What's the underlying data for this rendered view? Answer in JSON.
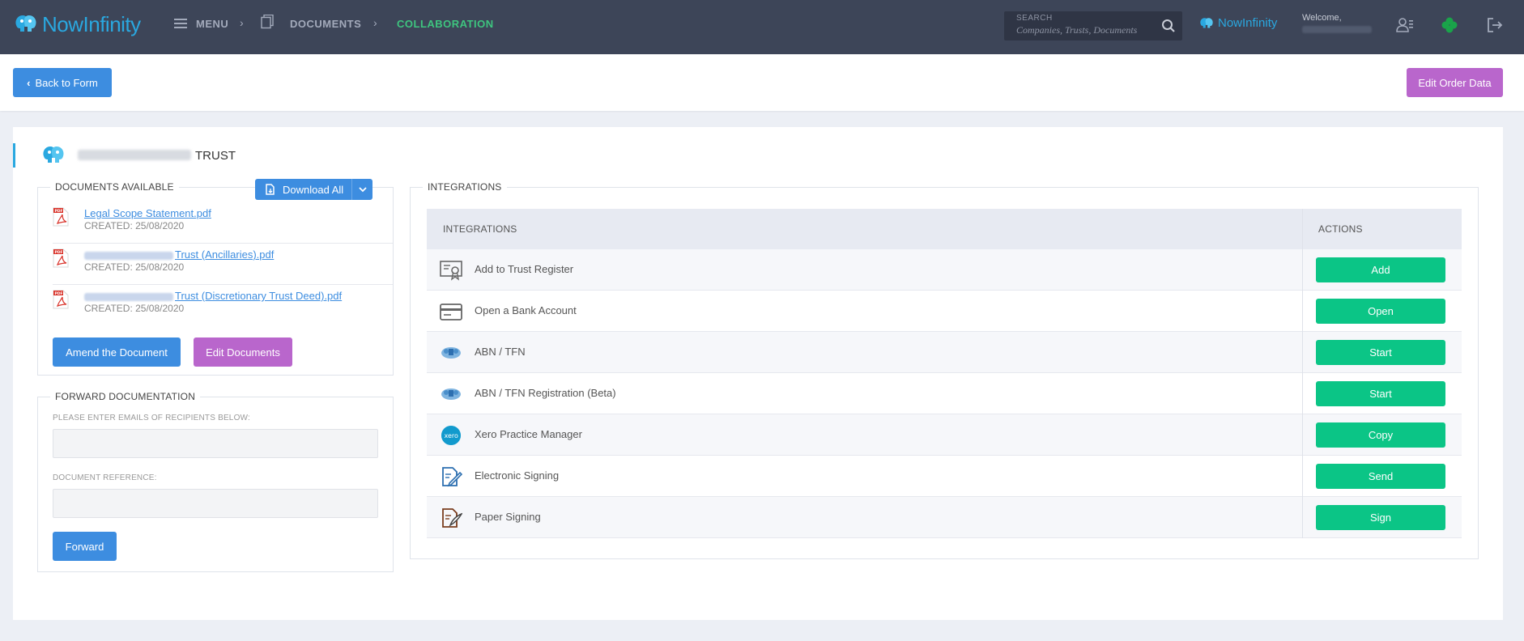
{
  "header": {
    "logo_text": "NowInfinity",
    "menu_label": "MENU",
    "documents_label": "DOCUMENTS",
    "collaboration_label": "COLLABORATION",
    "search_label": "SEARCH",
    "search_placeholder": "Companies,  Trusts,  Documents",
    "small_logo_text": "NowInfinity",
    "welcome_text": "Welcome,"
  },
  "toolbar": {
    "back_label": "Back to Form",
    "edit_order_label": "Edit Order Data"
  },
  "panel": {
    "title_suffix": "TRUST"
  },
  "documents": {
    "legend": "DOCUMENTS AVAILABLE",
    "download_all_label": "Download All",
    "items": [
      {
        "name": "Legal Scope Statement.pdf",
        "created": "CREATED: 25/08/2020"
      },
      {
        "name": "Trust (Ancillaries).pdf",
        "created": "CREATED: 25/08/2020"
      },
      {
        "name": "Trust (Discretionary Trust Deed).pdf",
        "created": "CREATED: 25/08/2020"
      }
    ],
    "amend_label": "Amend the Document",
    "edit_docs_label": "Edit Documents"
  },
  "forward": {
    "legend": "FORWARD DOCUMENTATION",
    "emails_label": "PLEASE ENTER EMAILS OF RECIPIENTS BELOW:",
    "reference_label": "DOCUMENT REFERENCE:",
    "forward_label": "Forward"
  },
  "integrations": {
    "legend": "INTEGRATIONS",
    "col_integrations": "INTEGRATIONS",
    "col_actions": "ACTIONS",
    "rows": [
      {
        "label": "Add to Trust Register",
        "action": "Add",
        "icon": "certificate-icon"
      },
      {
        "label": "Open a Bank Account",
        "action": "Open",
        "icon": "bank-card-icon"
      },
      {
        "label": "ABN / TFN",
        "action": "Start",
        "icon": "ato-crest-icon"
      },
      {
        "label": "ABN / TFN Registration (Beta)",
        "action": "Start",
        "icon": "ato-crest-icon"
      },
      {
        "label": "Xero Practice Manager",
        "action": "Copy",
        "icon": "xero-icon"
      },
      {
        "label": "Electronic Signing",
        "action": "Send",
        "icon": "e-sign-icon"
      },
      {
        "label": "Paper Signing",
        "action": "Sign",
        "icon": "paper-sign-icon"
      }
    ]
  },
  "colors": {
    "nav_bg": "#3d4558",
    "brand": "#2aa8e0",
    "primary": "#3d8de0",
    "purple": "#b966cc",
    "green": "#0bc586",
    "collab_active": "#3ec57f"
  }
}
